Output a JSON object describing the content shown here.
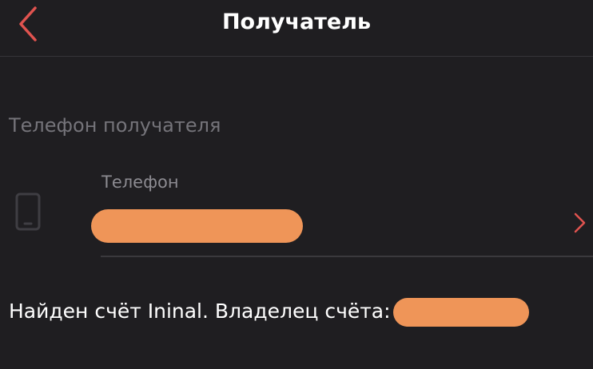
{
  "header": {
    "title": "Получатель",
    "back_icon": "chevron-left-icon"
  },
  "section": {
    "label": "Телефон получателя"
  },
  "phone_field": {
    "label": "Телефон",
    "value": "",
    "value_redacted": true,
    "icon": "smartphone-icon",
    "action_icon": "chevron-right-icon"
  },
  "account": {
    "text": "Найден счёт Ininal. Владелец счёта:",
    "owner": "",
    "owner_redacted": true
  },
  "colors": {
    "background": "#1f1e21",
    "accent": "#e0534f",
    "redaction": "#ef9558",
    "text_primary": "#ffffff",
    "text_secondary": "#75747a"
  }
}
